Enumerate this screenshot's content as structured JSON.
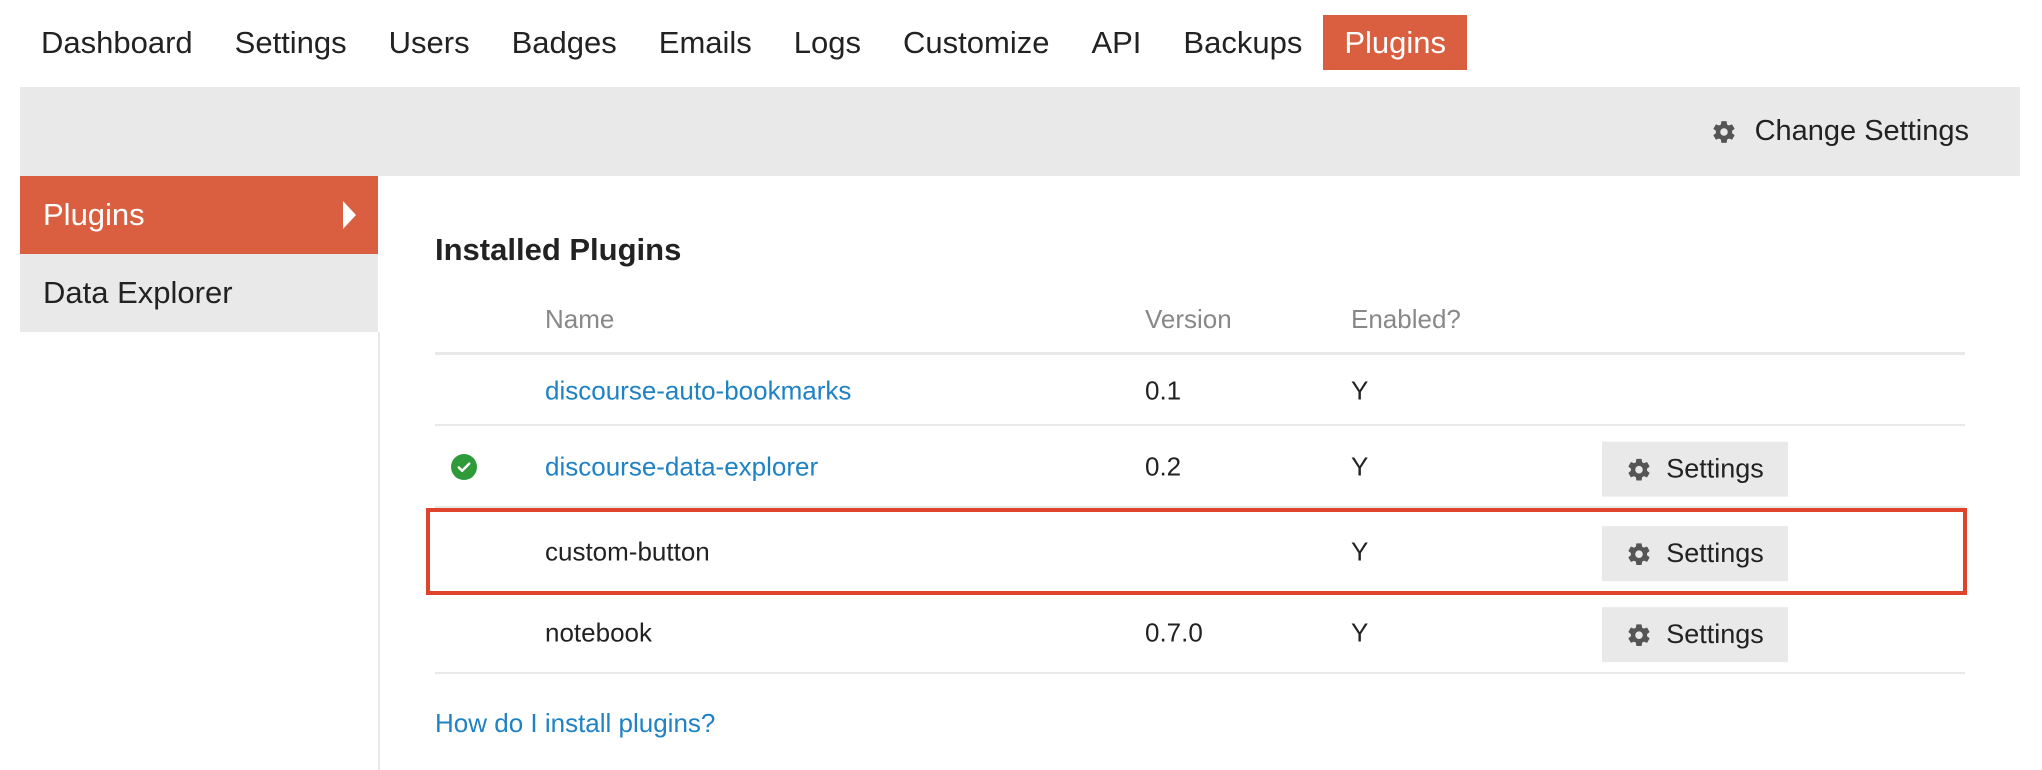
{
  "nav": {
    "items": [
      {
        "label": "Dashboard",
        "active": false
      },
      {
        "label": "Settings",
        "active": false
      },
      {
        "label": "Users",
        "active": false
      },
      {
        "label": "Badges",
        "active": false
      },
      {
        "label": "Emails",
        "active": false
      },
      {
        "label": "Logs",
        "active": false
      },
      {
        "label": "Customize",
        "active": false
      },
      {
        "label": "API",
        "active": false
      },
      {
        "label": "Backups",
        "active": false
      },
      {
        "label": "Plugins",
        "active": true
      }
    ]
  },
  "header": {
    "change_settings_label": "Change Settings",
    "change_settings_icon": "gear-icon"
  },
  "sidebar": {
    "items": [
      {
        "label": "Plugins",
        "active": true
      },
      {
        "label": "Data Explorer",
        "active": false
      }
    ]
  },
  "main": {
    "title": "Installed Plugins",
    "columns": {
      "name": "Name",
      "version": "Version",
      "enabled": "Enabled?"
    },
    "rows": [
      {
        "name": "discourse-auto-bookmarks",
        "version": "0.1",
        "enabled": "Y",
        "link": true,
        "check": false,
        "settings": null
      },
      {
        "name": "discourse-data-explorer",
        "version": "0.2",
        "enabled": "Y",
        "link": true,
        "check": true,
        "settings": "Settings"
      },
      {
        "name": "custom-button",
        "version": "",
        "enabled": "Y",
        "link": false,
        "check": false,
        "settings": "Settings"
      },
      {
        "name": "notebook",
        "version": "0.7.0",
        "enabled": "Y",
        "link": false,
        "check": false,
        "settings": "Settings"
      }
    ],
    "help_link": "How do I install plugins?"
  },
  "colors": {
    "accent": "#d95f40",
    "link": "#1e82c4",
    "highlight": "#e0432b",
    "check": "#2f9a3a",
    "panel": "#e9e9e9"
  }
}
